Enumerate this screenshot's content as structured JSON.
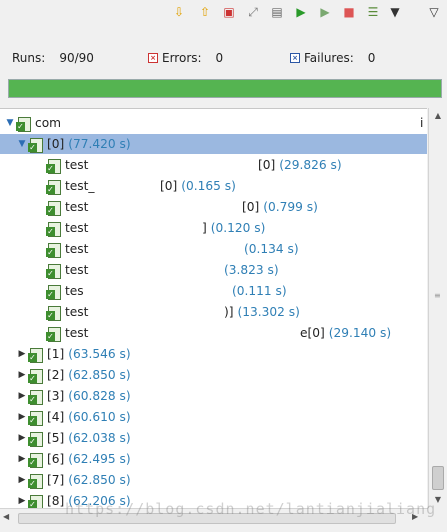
{
  "toolbar": {
    "buttons": [
      {
        "name": "next-failure-icon",
        "glyph": "⇩",
        "color": "#e0a000"
      },
      {
        "name": "previous-failure-icon",
        "glyph": "⇧",
        "color": "#e0a000"
      },
      {
        "name": "show-failures-only-icon",
        "glyph": "▣",
        "color": "#c33"
      },
      {
        "name": "scroll-lock-icon",
        "glyph": "⤢",
        "color": "#777"
      },
      {
        "name": "show-skipped-icon",
        "glyph": "▤",
        "color": "#666"
      },
      {
        "name": "rerun-test-icon",
        "glyph": "▶",
        "color": "#2a9a2a"
      },
      {
        "name": "rerun-failed-first-icon",
        "glyph": "▶",
        "color": "#7aa870"
      },
      {
        "name": "stop-icon",
        "glyph": "■",
        "color": "#d55"
      },
      {
        "name": "test-run-history-icon",
        "glyph": "☰",
        "color": "#5a8c3a"
      },
      {
        "name": "history-dropdown-icon",
        "glyph": "▼",
        "color": "#333"
      },
      {
        "name": "view-menu-icon",
        "glyph": "▽",
        "color": "#333"
      }
    ]
  },
  "stats": {
    "runs_label": "Runs:",
    "runs_value": "90/90",
    "errors_label": "Errors:",
    "errors_value": "0",
    "failures_label": "Failures:",
    "failures_value": "0"
  },
  "progress": {
    "fraction": 1.0,
    "color": "#55b451"
  },
  "tree": {
    "root": {
      "name": "com",
      "suffix": "i"
    },
    "selected": {
      "name": "[0]",
      "time": "(77.420 s)"
    },
    "tests": [
      {
        "name": "test",
        "tail": "[0]",
        "time": "(29.826 s)"
      },
      {
        "name": "test_",
        "tail": "[0]",
        "time": "(0.165 s)"
      },
      {
        "name": "test",
        "tail": "[0]",
        "time": "(0.799 s)"
      },
      {
        "name": "test",
        "tail": "]",
        "time": "(0.120 s)"
      },
      {
        "name": "test",
        "tail": "",
        "time": "(0.134 s)"
      },
      {
        "name": "test",
        "tail": "",
        "time": "(3.823 s)"
      },
      {
        "name": "tes",
        "tail": "",
        "time": "(0.111 s)"
      },
      {
        "name": "test",
        "tail": ")]",
        "time": "(13.302 s)"
      },
      {
        "name": "test",
        "tail": "e[0]",
        "time": "(29.140 s)"
      }
    ],
    "groups": [
      {
        "name": "[1]",
        "time": "(63.546 s)"
      },
      {
        "name": "[2]",
        "time": "(62.850 s)"
      },
      {
        "name": "[3]",
        "time": "(60.828 s)"
      },
      {
        "name": "[4]",
        "time": "(60.610 s)"
      },
      {
        "name": "[5]",
        "time": "(62.038 s)"
      },
      {
        "name": "[6]",
        "time": "(62.495 s)"
      },
      {
        "name": "[7]",
        "time": "(62.850 s)"
      },
      {
        "name": "[8]",
        "time": "(62.206 s)"
      }
    ]
  },
  "watermark": "https://blog.csdn.net/lantianjialiang"
}
